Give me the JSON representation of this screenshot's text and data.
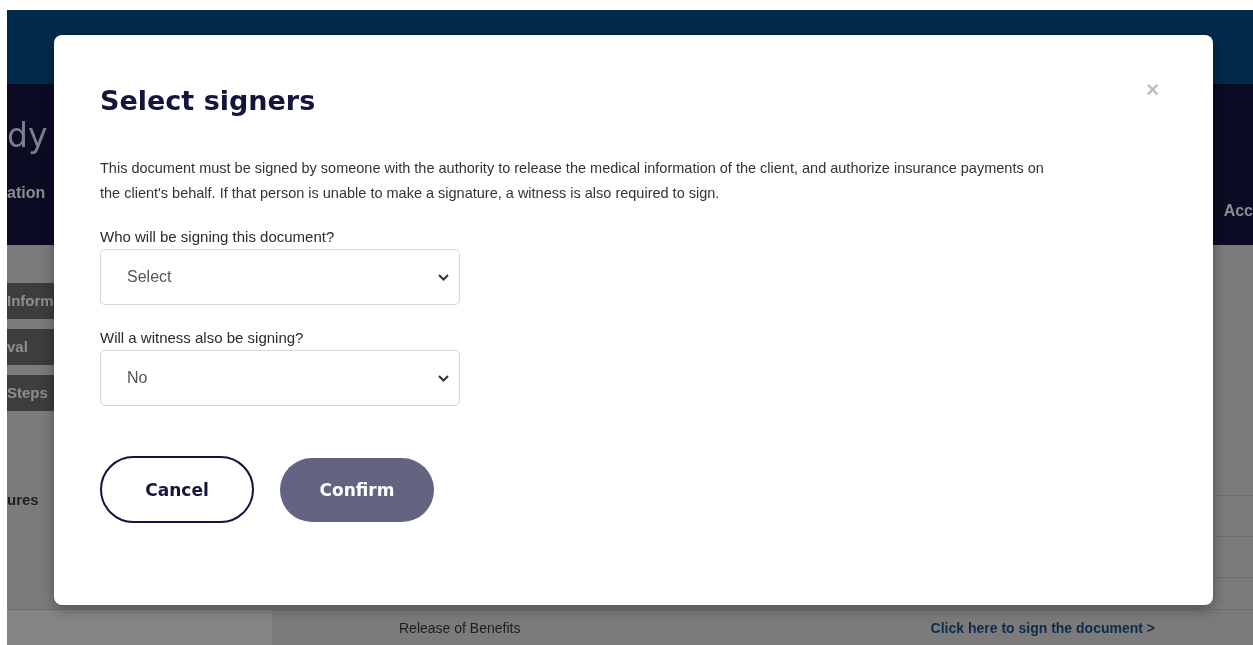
{
  "background": {
    "logo_fragment": "dy",
    "nav_items": [
      {
        "label": "ation"
      },
      {
        "label": "Acc"
      }
    ],
    "side_tabs": [
      {
        "label": "Inform"
      },
      {
        "label": "val"
      },
      {
        "label": "Steps"
      }
    ],
    "section_label": "ures",
    "table_row": {
      "document": "Release of Benefits",
      "action": "Click here to sign the document >"
    }
  },
  "dialog": {
    "title": "Select signers",
    "close": "×",
    "message": "This document must be signed by someone with the authority to release the medical information of the client, and authorize insurance payments on the client's behalf. If that person is unable to make a signature, a witness is also required to sign.",
    "fields": [
      {
        "label": "Who will be signing this document?",
        "value": "Select"
      },
      {
        "label": "Will a witness also be signing?",
        "value": "No"
      }
    ],
    "buttons": [
      {
        "label": "Cancel",
        "kind": "secondary"
      },
      {
        "label": "Confirm",
        "kind": "primary"
      }
    ]
  }
}
